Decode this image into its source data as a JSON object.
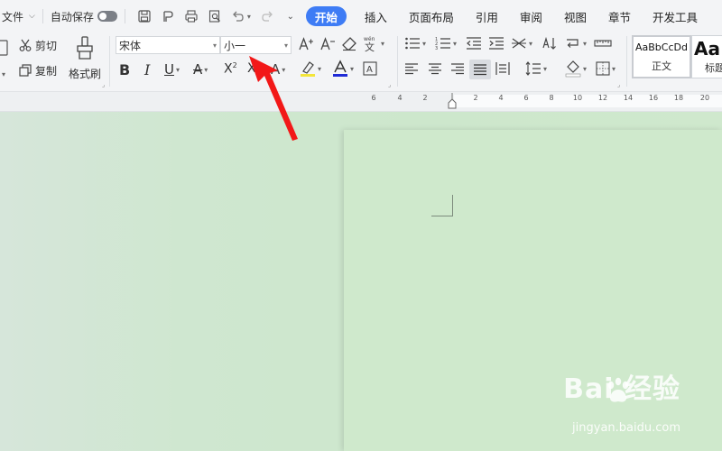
{
  "tabbar": {
    "file_label": "文件",
    "autosave_label": "自动保存",
    "tabs": [
      "开始",
      "插入",
      "页面布局",
      "引用",
      "审阅",
      "视图",
      "章节",
      "开发工具"
    ],
    "active_tab": "开始"
  },
  "ribbon": {
    "cut_label": "剪切",
    "copy_label": "复制",
    "format_painter_label": "格式刷",
    "font_name": "宋体",
    "font_size": "小一",
    "styles": [
      {
        "preview": "AaBbCcDd",
        "name": "正文"
      },
      {
        "preview": "Aa",
        "name": "标题"
      }
    ],
    "accent_color": "#3e7cf5",
    "font_color_bar": "#1f2bd6",
    "highlight_bar": "#f3e53a"
  },
  "ruler": {
    "ticks": [
      "6",
      "4",
      "2",
      "2",
      "4",
      "6",
      "8",
      "10",
      "12",
      "14",
      "16",
      "18",
      "20"
    ]
  },
  "watermark": {
    "brand": "Bai  经验",
    "url": "jingyan.baidu.com"
  }
}
